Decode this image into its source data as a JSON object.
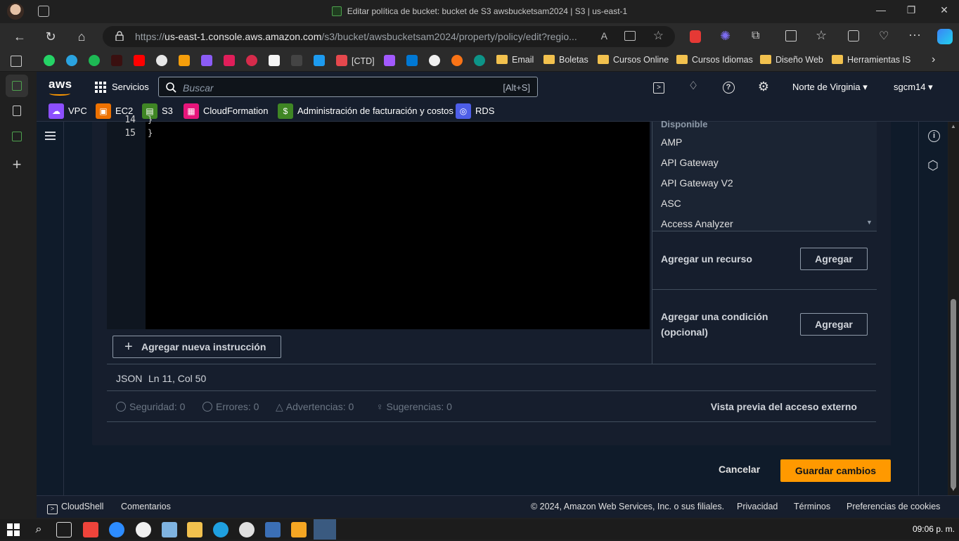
{
  "browser": {
    "window_title": "Editar política de bucket: bucket de S3 awsbucketsam2024 | S3 | us-east-1",
    "url_prefix": "https://",
    "url_host": "us-east-1.console.aws.amazon.com",
    "url_path": "/s3/bucket/awsbucketsam2024/property/policy/edit?regio...",
    "bookmarks": [
      "[CTD]",
      "Email",
      "Boletas",
      "Cursos Online",
      "Cursos Idiomas",
      "Diseño Web",
      "Herramientas IS"
    ]
  },
  "aws_header": {
    "logo": "aws",
    "services_label": "Servicios",
    "search_placeholder": "Buscar",
    "search_shortcut": "[Alt+S]",
    "region": "Norte de Virginia",
    "user": "sgcm14",
    "favorites": [
      "VPC",
      "EC2",
      "S3",
      "CloudFormation",
      "Administración de facturación y costos",
      "RDS"
    ]
  },
  "editor": {
    "lines": [
      {
        "num": "14",
        "code": "}"
      },
      {
        "num": "15",
        "code": "}"
      }
    ],
    "add_instruction_label": "Agregar nueva instrucción"
  },
  "side_panel": {
    "section_heading": "Disponible",
    "services": [
      "AMP",
      "API Gateway",
      "API Gateway V2",
      "ASC",
      "Access Analyzer"
    ],
    "add_resource_label": "Agregar un recurso",
    "add_resource_button": "Agregar",
    "add_condition_label": "Agregar una condición (opcional)",
    "add_condition_button": "Agregar"
  },
  "status": {
    "language": "JSON",
    "position": "Ln 11, Col 50"
  },
  "validation": {
    "security": "Seguridad: 0",
    "errors": "Errores: 0",
    "warnings": "Advertencias: 0",
    "suggestions": "Sugerencias: 0",
    "preview_label": "Vista previa del acceso externo"
  },
  "actions": {
    "cancel": "Cancelar",
    "save": "Guardar cambios"
  },
  "footer": {
    "cloudshell": "CloudShell",
    "feedback": "Comentarios",
    "copyright": "© 2024, Amazon Web Services, Inc. o sus filiales.",
    "privacy": "Privacidad",
    "terms": "Términos",
    "cookies": "Preferencias de cookies"
  },
  "taskbar": {
    "clock": "09:06 p. m."
  },
  "colors": {
    "aws_header_bg": "#161e2d",
    "primary_button": "#ff9900"
  }
}
